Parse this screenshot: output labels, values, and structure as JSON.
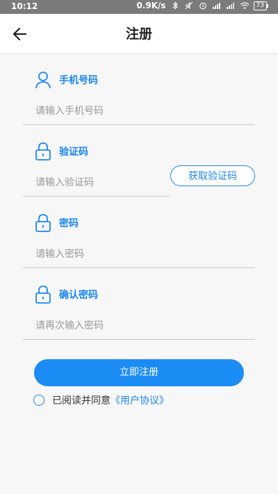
{
  "status_bar": {
    "time": "10:12",
    "speed": "0.9K/s",
    "battery": "73"
  },
  "app_bar": {
    "title": "注册"
  },
  "form": {
    "phone": {
      "label": "手机号码",
      "placeholder": "请输入手机号码"
    },
    "code": {
      "label": "验证码",
      "placeholder": "请输入验证码",
      "button": "获取验证码"
    },
    "password": {
      "label": "密码",
      "placeholder": "请输入密码"
    },
    "confirm": {
      "label": "确认密码",
      "placeholder": "请再次输入密码"
    }
  },
  "actions": {
    "register": "立即注册"
  },
  "agreement": {
    "text": "已阅读并同意",
    "link": "《用户协议》"
  },
  "colors": {
    "accent": "#1b86f0",
    "button": "#1b8cf3",
    "status_bar": "#7b7b7b"
  }
}
